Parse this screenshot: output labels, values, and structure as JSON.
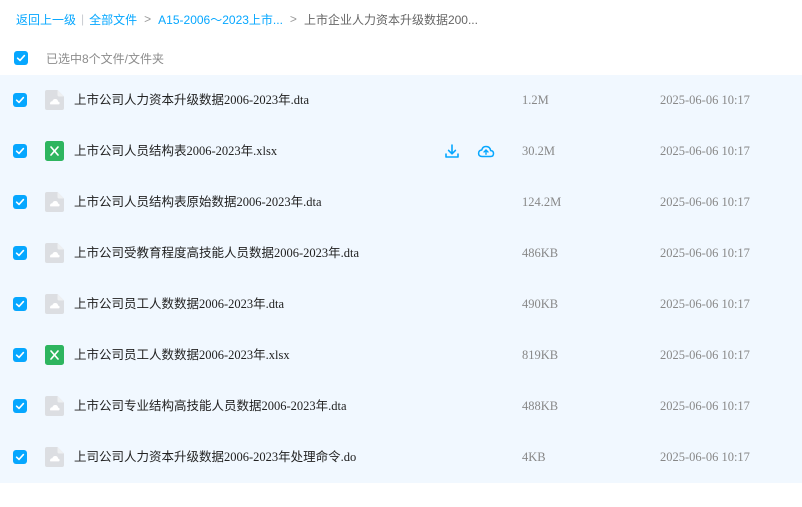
{
  "breadcrumb": {
    "back": "返回上一级",
    "all_files": "全部文件",
    "folder": "A15-2006～2023上市...",
    "current": "上市企业人力资本升级数据200...",
    "separator": ">",
    "pipe": "|"
  },
  "selection": {
    "text": "已选中8个文件/文件夹",
    "all_checked": true
  },
  "colors": {
    "accent": "#06a7ff",
    "row_background": "#f1f8ff",
    "excel_icon": "#2eb55f",
    "generic_icon": "#dcdee2"
  },
  "files": [
    {
      "name": "上市公司人力资本升级数据2006-2023年.dta",
      "size": "1.2M",
      "date": "2025-06-06 10:17",
      "type": "generic-file-icon",
      "checked": true
    },
    {
      "name": "上市公司人员结构表2006-2023年.xlsx",
      "size": "30.2M",
      "date": "2025-06-06 10:17",
      "type": "excel-file-icon",
      "checked": true,
      "hover_actions": [
        "download-icon",
        "cloud-save-icon"
      ]
    },
    {
      "name": "上市公司人员结构表原始数据2006-2023年.dta",
      "size": "124.2M",
      "date": "2025-06-06 10:17",
      "type": "generic-file-icon",
      "checked": true
    },
    {
      "name": "上市公司受教育程度高技能人员数据2006-2023年.dta",
      "size": "486KB",
      "date": "2025-06-06 10:17",
      "type": "generic-file-icon",
      "checked": true
    },
    {
      "name": "上市公司员工人数数据2006-2023年.dta",
      "size": "490KB",
      "date": "2025-06-06 10:17",
      "type": "generic-file-icon",
      "checked": true
    },
    {
      "name": "上市公司员工人数数据2006-2023年.xlsx",
      "size": "819KB",
      "date": "2025-06-06 10:17",
      "type": "excel-file-icon",
      "checked": true
    },
    {
      "name": "上市公司专业结构高技能人员数据2006-2023年.dta",
      "size": "488KB",
      "date": "2025-06-06 10:17",
      "type": "generic-file-icon",
      "checked": true
    },
    {
      "name": "上司公司人力资本升级数据2006-2023年处理命令.do",
      "size": "4KB",
      "date": "2025-06-06 10:17",
      "type": "generic-file-icon",
      "checked": true
    }
  ]
}
